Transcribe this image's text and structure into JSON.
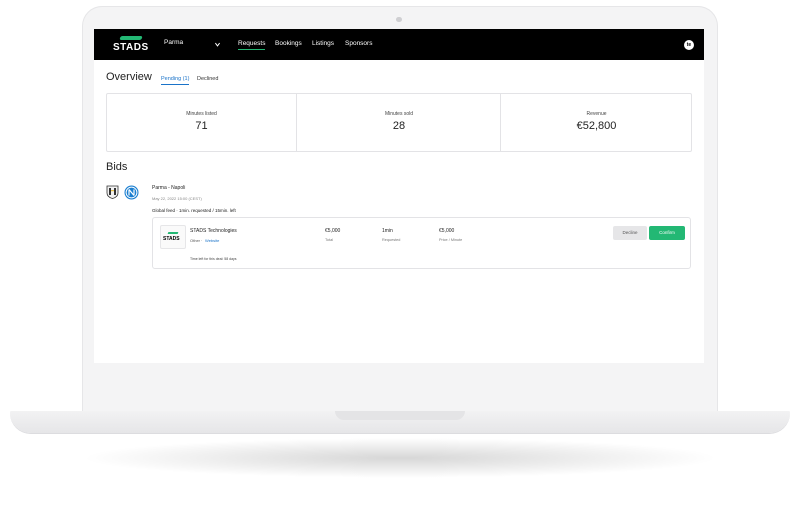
{
  "header": {
    "logo": "STADS",
    "team_select": "Parma",
    "nav": [
      "Requests",
      "Bookings",
      "Listings",
      "Sponsors"
    ],
    "avatar": "te"
  },
  "overview": {
    "title": "Overview",
    "tabs": [
      "Pending (1)",
      "Declined"
    ],
    "stats": [
      {
        "label": "Minutes listed",
        "value": "71"
      },
      {
        "label": "Minutes sold",
        "value": "28"
      },
      {
        "label": "Revenue",
        "value": "€52,800"
      }
    ]
  },
  "bids": {
    "title": "Bids",
    "match": "Parma - Napoli",
    "date": "May 22, 2022 15:00 (CEST)",
    "feed_info": "Global feed · 1min. requested / 15min. left",
    "card": {
      "logo": "STADS",
      "company": "STADS Technologies",
      "type": "Other ·",
      "link": "Website",
      "total_value": "€5,000",
      "total_label": "Total",
      "requested_value": "1min",
      "requested_label": "Requested",
      "price_value": "€5,000",
      "price_label": "Price / Minute",
      "decline": "Decline",
      "confirm": "Confirm",
      "time_left": "Time left for this deal: 58 days"
    }
  },
  "colors": {
    "accent": "#23b874",
    "link": "#1a73c9",
    "topbar": "#000000"
  },
  "icons": [
    "parma-crest-icon",
    "napoli-crest-icon",
    "chevron-down-icon"
  ]
}
